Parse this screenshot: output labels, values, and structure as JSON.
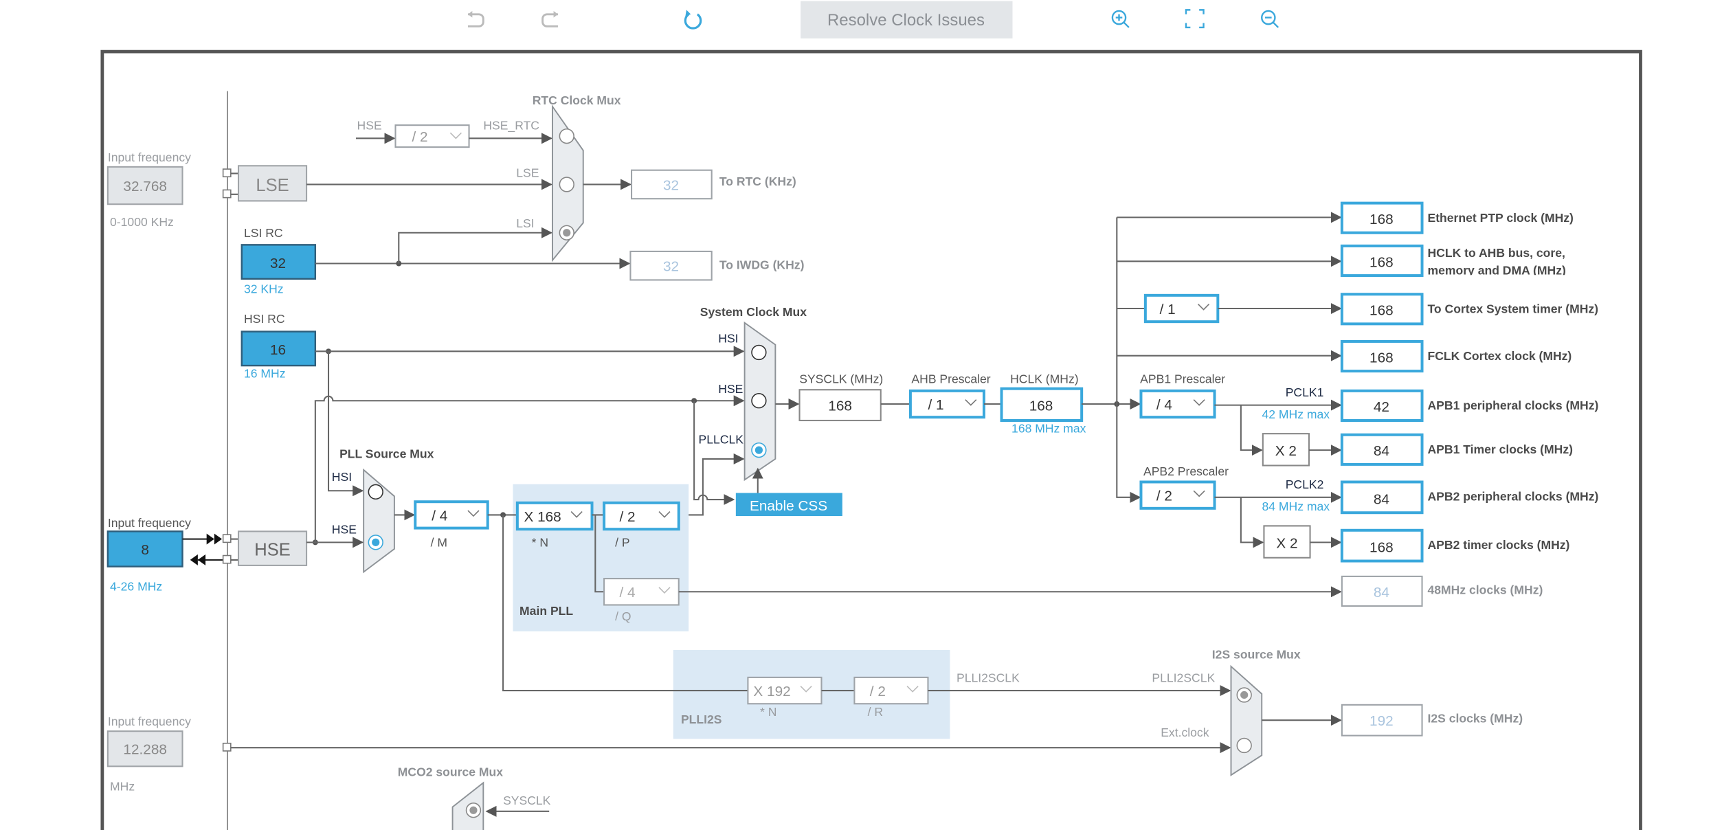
{
  "toolbar": {
    "undo_icon": "undo-icon",
    "redo_icon": "redo-icon",
    "refresh_icon": "refresh-icon",
    "resolve_label": "Resolve Clock Issues",
    "zoom_in_icon": "zoom-in-icon",
    "fit_icon": "fit-to-screen-icon",
    "zoom_out_icon": "zoom-out-icon"
  },
  "lse": {
    "input_label": "Input frequency",
    "value": "32.768",
    "range": "0-1000 KHz",
    "block": "LSE"
  },
  "lsi": {
    "title": "LSI RC",
    "value": "32",
    "unit": "32 KHz"
  },
  "hsi": {
    "title": "HSI RC",
    "value": "16",
    "unit": "16 MHz"
  },
  "hse": {
    "input_label": "Input frequency",
    "value": "8",
    "range": "4-26 MHz",
    "block": "HSE"
  },
  "ext": {
    "input_label": "Input frequency",
    "value": "12.288",
    "unit": "MHz"
  },
  "rtc_mux": {
    "title": "RTC Clock Mux",
    "hse_label": "HSE",
    "divider": "/ 2",
    "inputs": [
      "HSE_RTC",
      "LSE",
      "LSI"
    ],
    "selected": "LSI",
    "rtc_value": "32",
    "rtc_label": "To RTC (KHz)",
    "iwdg_value": "32",
    "iwdg_label": "To IWDG (KHz)"
  },
  "sys_mux": {
    "title": "System Clock Mux",
    "inputs": [
      "HSI",
      "HSE",
      "PLLCLK"
    ],
    "selected": "PLLCLK",
    "enable_css": "Enable CSS"
  },
  "sysclk": {
    "label": "SYSCLK (MHz)",
    "value": "168"
  },
  "ahb": {
    "label": "AHB Prescaler",
    "value": "/ 1"
  },
  "hclk": {
    "label": "HCLK (MHz)",
    "value": "168",
    "max": "168 MHz max"
  },
  "cortex_div": "/ 1",
  "apb1": {
    "label": "APB1 Prescaler",
    "value": "/ 4",
    "pclk": "PCLK1",
    "max": "42 MHz max",
    "multiplier": "X 2"
  },
  "apb2": {
    "label": "APB2 Prescaler",
    "value": "/ 2",
    "pclk": "PCLK2",
    "max": "84 MHz max",
    "multiplier": "X 2"
  },
  "outputs": [
    {
      "value": "168",
      "label": "Ethernet PTP clock (MHz)"
    },
    {
      "value": "168",
      "label": "HCLK to AHB bus, core,",
      "label2": "memory and DMA (MHz)"
    },
    {
      "value": "168",
      "label": "To Cortex System timer (MHz)"
    },
    {
      "value": "168",
      "label": "FCLK Cortex clock (MHz)"
    },
    {
      "value": "42",
      "label": "APB1 peripheral clocks (MHz)"
    },
    {
      "value": "84",
      "label": "APB1 Timer clocks (MHz)"
    },
    {
      "value": "84",
      "label": "APB2 peripheral clocks (MHz)"
    },
    {
      "value": "168",
      "label": "APB2 timer clocks (MHz)"
    },
    {
      "value": "84",
      "label": "48MHz clocks (MHz)"
    }
  ],
  "pll_mux": {
    "title": "PLL Source Mux",
    "inputs": [
      "HSI",
      "HSE"
    ],
    "selected": "HSE"
  },
  "main_pll": {
    "title": "Main PLL",
    "m": "/ 4",
    "m_label": "/ M",
    "n": "X 168",
    "n_label": "* N",
    "p": "/ 2",
    "p_label": "/ P",
    "q": "/ 4",
    "q_label": "/ Q"
  },
  "plli2s": {
    "title": "PLLI2S",
    "n": "X 192",
    "n_label": "* N",
    "r": "/ 2",
    "r_label": "/ R",
    "out_label": "PLLI2SCLK"
  },
  "i2s_mux": {
    "title": "I2S source Mux",
    "inputs": [
      "PLLI2SCLK",
      "Ext.clock"
    ],
    "selected": "PLLI2SCLK",
    "out_value": "192",
    "out_label": "I2S clocks (MHz)"
  },
  "mco2_mux": {
    "title": "MCO2 source Mux",
    "input": "SYSCLK"
  },
  "colors": {
    "accent": "#3aa8dc",
    "disabled_box": "#e3e6e9",
    "pll_region": "#dbe9f5",
    "line": "#666666"
  }
}
